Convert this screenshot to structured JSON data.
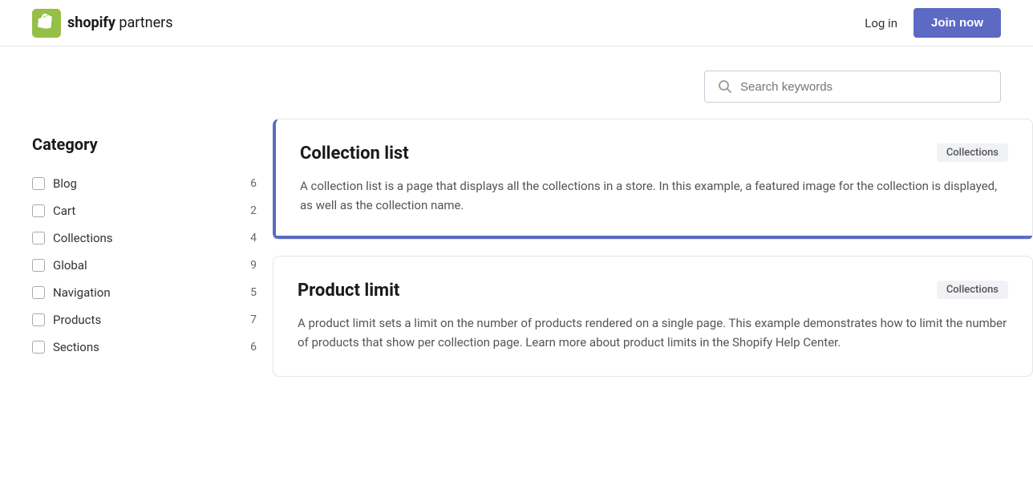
{
  "header": {
    "logo_brand": "shopify",
    "logo_suffix": "partners",
    "login_label": "Log in",
    "join_label": "Join now"
  },
  "search": {
    "placeholder": "Search keywords"
  },
  "sidebar": {
    "title": "Category",
    "items": [
      {
        "label": "Blog",
        "count": 6,
        "checked": false
      },
      {
        "label": "Cart",
        "count": 2,
        "checked": false
      },
      {
        "label": "Collections",
        "count": 4,
        "checked": false
      },
      {
        "label": "Global",
        "count": 9,
        "checked": false
      },
      {
        "label": "Navigation",
        "count": 5,
        "checked": false
      },
      {
        "label": "Products",
        "count": 7,
        "checked": false
      },
      {
        "label": "Sections",
        "count": 6,
        "checked": false
      }
    ]
  },
  "cards": [
    {
      "title": "Collection list",
      "badge": "Collections",
      "description": "A collection list is a page that displays all the collections in a store. In this example, a featured image for the collection is displayed, as well as the collection name.",
      "accent": true
    },
    {
      "title": "Product limit",
      "badge": "Collections",
      "description": "A product limit sets a limit on the number of products rendered on a single page. This example demonstrates how to limit the number of products that show per collection page. Learn more about product limits in the Shopify Help Center.",
      "accent": false
    }
  ],
  "colors": {
    "accent": "#5c6ac4",
    "badge_bg": "#f1f2f5"
  }
}
